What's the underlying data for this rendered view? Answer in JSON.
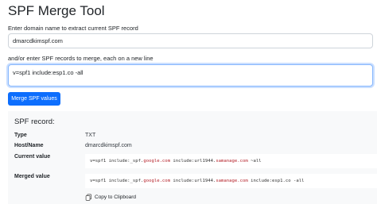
{
  "page": {
    "title": "SPF Merge Tool",
    "domain_label": "Enter domain name to extract current SPF record",
    "domain_value": "dmarcdkimspf.com",
    "records_label": "and/or enter SPF records to merge, each on a new line",
    "records_value": "v=spf1 include:esp1.co -all",
    "merge_button": "Merge SPF values"
  },
  "result": {
    "title": "SPF record:",
    "type_key": "Type",
    "type_value": "TXT",
    "host_key": "Host/Name",
    "host_value": "dmarcdkimspf.com",
    "current_key": "Current value",
    "current": {
      "p1": "v=spf1 include:_spf.",
      "h1": "google.com",
      "p2": " include:url1944.",
      "h2": "samanage.com",
      "p3": " ~all"
    },
    "merged_key": "Merged value",
    "merged": {
      "p1": "v=spf1 include:_spf.",
      "h1": "google.com",
      "p2": " include:url1944.",
      "h2": "samanage.com",
      "p3": " include:esp1.co -all"
    },
    "copy_label": "Copy to Clipboard"
  },
  "colors": {
    "primary": "#0d6efd",
    "highlight": "#b5222a",
    "panel_bg": "#f8f9fa"
  },
  "icons": {
    "copy": "clipboard-icon"
  }
}
